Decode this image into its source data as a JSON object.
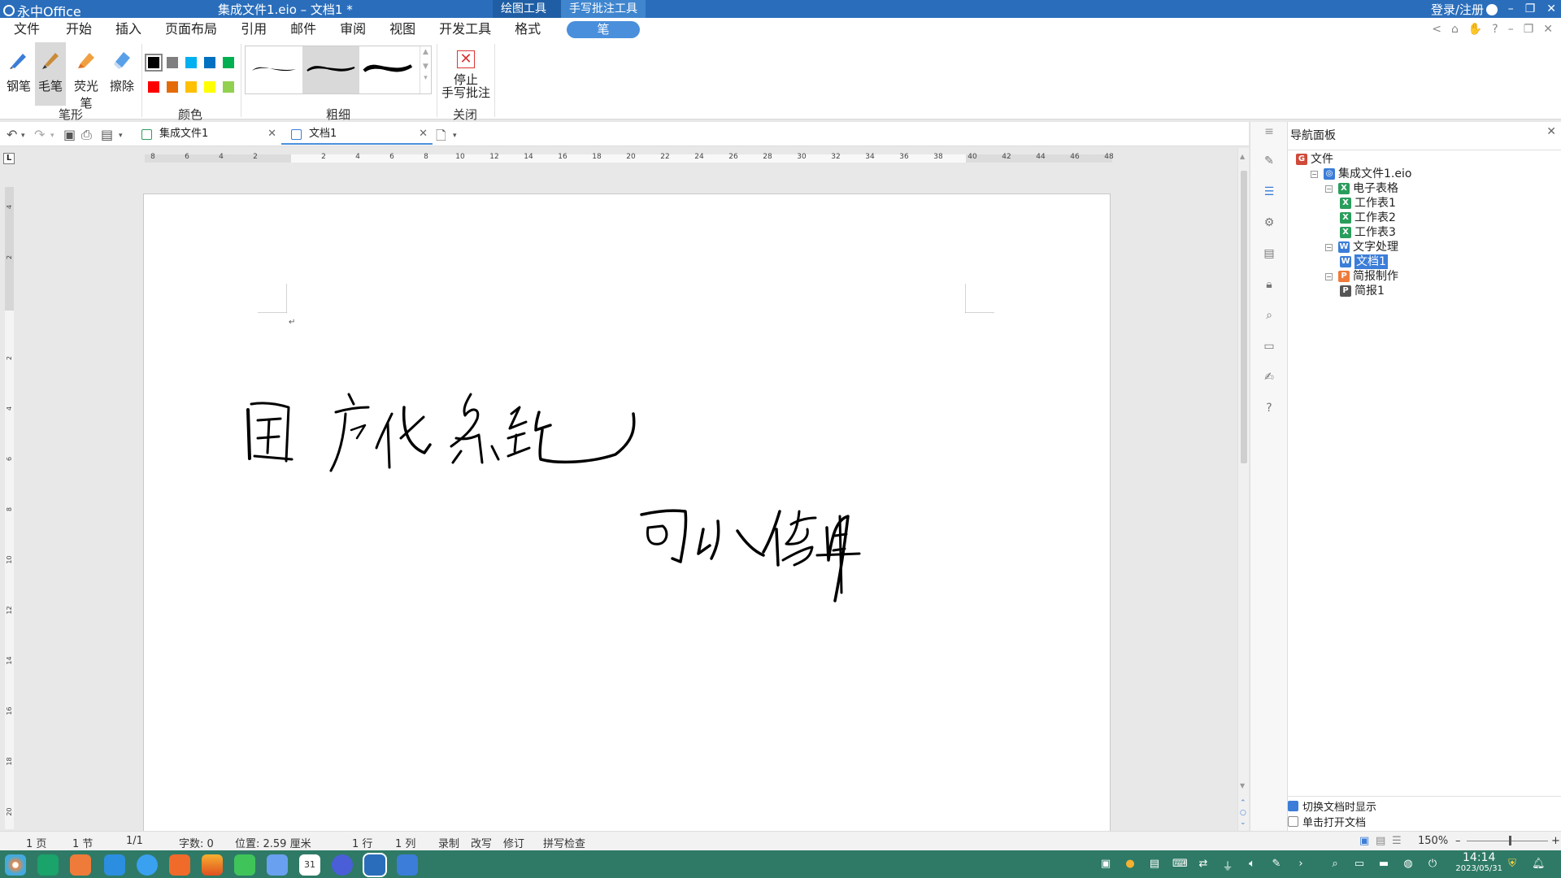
{
  "titlebar": {
    "app_name": "永中Office",
    "doc_title": "集成文件1.eio – 文档1 *",
    "context_tabs": [
      "绘图工具",
      "手写批注工具"
    ],
    "login": "登录/注册",
    "min": "–",
    "max": "❐",
    "close": "✕"
  },
  "menu": {
    "items": [
      "文件",
      "开始",
      "插入",
      "页面布局",
      "引用",
      "邮件",
      "审阅",
      "视图",
      "开发工具",
      "格式"
    ],
    "active": "笔",
    "right_icons": [
      "<",
      "⌂",
      "✋",
      "?",
      "–",
      "❐",
      "✕"
    ]
  },
  "ribbon": {
    "pen_tools": [
      {
        "label": "钢笔",
        "icon": "fountain-pen-icon",
        "selected": false
      },
      {
        "label": "毛笔",
        "icon": "brush-icon",
        "selected": true
      },
      {
        "label": "荧光笔",
        "icon": "highlighter-icon",
        "selected": false
      },
      {
        "label": "擦除",
        "icon": "eraser-icon",
        "selected": false
      }
    ],
    "group_pen": "笔形",
    "colors": [
      "#000000",
      "#7f7f7f",
      "#00b0f0",
      "#0070c0",
      "#00b050",
      "#ff0000",
      "#e36c09",
      "#ffc000",
      "#ffff00",
      "#92d050"
    ],
    "selected_color": "#000000",
    "group_color": "颜色",
    "thickness_selected": 2,
    "group_thickness": "粗细",
    "stop_line1": "停止",
    "stop_line2": "手写批注",
    "group_close": "关闭"
  },
  "doc_tabs": [
    {
      "label": "集成文件1",
      "active": false
    },
    {
      "label": "文档1",
      "active": true
    }
  ],
  "ruler": {
    "marks": [
      "8",
      "6",
      "4",
      "2",
      "",
      "2",
      "4",
      "6",
      "8",
      "10",
      "12",
      "14",
      "16",
      "18",
      "20",
      "22",
      "24",
      "26",
      "28",
      "30",
      "32",
      "34",
      "36",
      "38",
      "40",
      "42",
      "44",
      "46",
      "48"
    ],
    "vmarks": [
      "4",
      "2",
      "",
      "2",
      "4",
      "6",
      "8",
      "10",
      "12",
      "14",
      "16",
      "18",
      "20"
    ]
  },
  "document": {
    "paragraph_mark": "↵"
  },
  "nav": {
    "title": "导航面板",
    "tree": [
      {
        "label": "文件",
        "level": 0,
        "type": "root"
      },
      {
        "label": "集成文件1.eio",
        "level": 1,
        "type": "file"
      },
      {
        "label": "电子表格",
        "level": 2,
        "type": "sheet"
      },
      {
        "label": "工作表1",
        "level": 3,
        "type": "sheet"
      },
      {
        "label": "工作表2",
        "level": 3,
        "type": "sheet"
      },
      {
        "label": "工作表3",
        "level": 3,
        "type": "sheet"
      },
      {
        "label": "文字处理",
        "level": 2,
        "type": "word"
      },
      {
        "label": "文档1",
        "level": 3,
        "type": "word",
        "selected": true
      },
      {
        "label": "简报制作",
        "level": 2,
        "type": "ppt"
      },
      {
        "label": "简报1",
        "level": 3,
        "type": "ppt2"
      }
    ],
    "opt_switch": "切换文档时显示",
    "opt_switch_on": true,
    "opt_click": "单击打开文档",
    "opt_click_on": false
  },
  "status": {
    "page": "1 页",
    "section": "1 节",
    "pages": "1/1",
    "words": "字数: 0",
    "position": "位置: 2.59 厘米",
    "line": "1 行",
    "col": "1 列",
    "record": "录制",
    "overwrite": "改写",
    "revise": "修订",
    "spell": "拼写检查",
    "zoom": "150%"
  },
  "taskbar": {
    "time": "14:14",
    "date": "2023/05/31",
    "calendar_day": "31"
  },
  "colors": {
    "accent": "#2a6ebb",
    "taskbar": "#2e7a66",
    "pen_pill": "#4a8fdc"
  }
}
